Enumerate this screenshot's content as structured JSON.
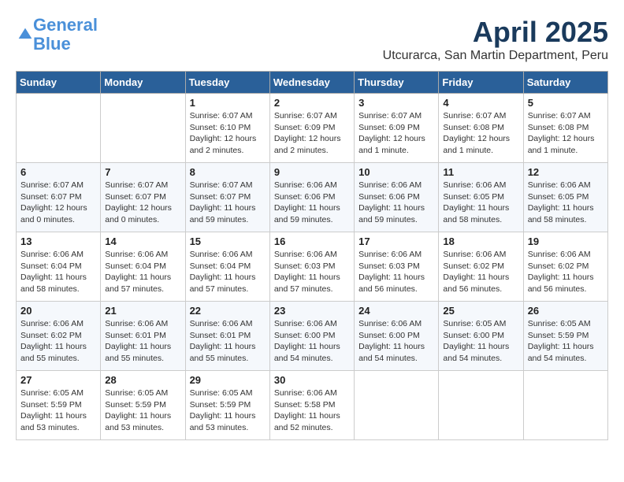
{
  "header": {
    "logo_line1": "General",
    "logo_line2": "Blue",
    "month": "April 2025",
    "location": "Utcurarca, San Martin Department, Peru"
  },
  "days_of_week": [
    "Sunday",
    "Monday",
    "Tuesday",
    "Wednesday",
    "Thursday",
    "Friday",
    "Saturday"
  ],
  "weeks": [
    [
      {
        "day": "",
        "text": ""
      },
      {
        "day": "",
        "text": ""
      },
      {
        "day": "1",
        "text": "Sunrise: 6:07 AM\nSunset: 6:10 PM\nDaylight: 12 hours\nand 2 minutes."
      },
      {
        "day": "2",
        "text": "Sunrise: 6:07 AM\nSunset: 6:09 PM\nDaylight: 12 hours\nand 2 minutes."
      },
      {
        "day": "3",
        "text": "Sunrise: 6:07 AM\nSunset: 6:09 PM\nDaylight: 12 hours\nand 1 minute."
      },
      {
        "day": "4",
        "text": "Sunrise: 6:07 AM\nSunset: 6:08 PM\nDaylight: 12 hours\nand 1 minute."
      },
      {
        "day": "5",
        "text": "Sunrise: 6:07 AM\nSunset: 6:08 PM\nDaylight: 12 hours\nand 1 minute."
      }
    ],
    [
      {
        "day": "6",
        "text": "Sunrise: 6:07 AM\nSunset: 6:07 PM\nDaylight: 12 hours\nand 0 minutes."
      },
      {
        "day": "7",
        "text": "Sunrise: 6:07 AM\nSunset: 6:07 PM\nDaylight: 12 hours\nand 0 minutes."
      },
      {
        "day": "8",
        "text": "Sunrise: 6:07 AM\nSunset: 6:07 PM\nDaylight: 11 hours\nand 59 minutes."
      },
      {
        "day": "9",
        "text": "Sunrise: 6:06 AM\nSunset: 6:06 PM\nDaylight: 11 hours\nand 59 minutes."
      },
      {
        "day": "10",
        "text": "Sunrise: 6:06 AM\nSunset: 6:06 PM\nDaylight: 11 hours\nand 59 minutes."
      },
      {
        "day": "11",
        "text": "Sunrise: 6:06 AM\nSunset: 6:05 PM\nDaylight: 11 hours\nand 58 minutes."
      },
      {
        "day": "12",
        "text": "Sunrise: 6:06 AM\nSunset: 6:05 PM\nDaylight: 11 hours\nand 58 minutes."
      }
    ],
    [
      {
        "day": "13",
        "text": "Sunrise: 6:06 AM\nSunset: 6:04 PM\nDaylight: 11 hours\nand 58 minutes."
      },
      {
        "day": "14",
        "text": "Sunrise: 6:06 AM\nSunset: 6:04 PM\nDaylight: 11 hours\nand 57 minutes."
      },
      {
        "day": "15",
        "text": "Sunrise: 6:06 AM\nSunset: 6:04 PM\nDaylight: 11 hours\nand 57 minutes."
      },
      {
        "day": "16",
        "text": "Sunrise: 6:06 AM\nSunset: 6:03 PM\nDaylight: 11 hours\nand 57 minutes."
      },
      {
        "day": "17",
        "text": "Sunrise: 6:06 AM\nSunset: 6:03 PM\nDaylight: 11 hours\nand 56 minutes."
      },
      {
        "day": "18",
        "text": "Sunrise: 6:06 AM\nSunset: 6:02 PM\nDaylight: 11 hours\nand 56 minutes."
      },
      {
        "day": "19",
        "text": "Sunrise: 6:06 AM\nSunset: 6:02 PM\nDaylight: 11 hours\nand 56 minutes."
      }
    ],
    [
      {
        "day": "20",
        "text": "Sunrise: 6:06 AM\nSunset: 6:02 PM\nDaylight: 11 hours\nand 55 minutes."
      },
      {
        "day": "21",
        "text": "Sunrise: 6:06 AM\nSunset: 6:01 PM\nDaylight: 11 hours\nand 55 minutes."
      },
      {
        "day": "22",
        "text": "Sunrise: 6:06 AM\nSunset: 6:01 PM\nDaylight: 11 hours\nand 55 minutes."
      },
      {
        "day": "23",
        "text": "Sunrise: 6:06 AM\nSunset: 6:00 PM\nDaylight: 11 hours\nand 54 minutes."
      },
      {
        "day": "24",
        "text": "Sunrise: 6:06 AM\nSunset: 6:00 PM\nDaylight: 11 hours\nand 54 minutes."
      },
      {
        "day": "25",
        "text": "Sunrise: 6:05 AM\nSunset: 6:00 PM\nDaylight: 11 hours\nand 54 minutes."
      },
      {
        "day": "26",
        "text": "Sunrise: 6:05 AM\nSunset: 5:59 PM\nDaylight: 11 hours\nand 54 minutes."
      }
    ],
    [
      {
        "day": "27",
        "text": "Sunrise: 6:05 AM\nSunset: 5:59 PM\nDaylight: 11 hours\nand 53 minutes."
      },
      {
        "day": "28",
        "text": "Sunrise: 6:05 AM\nSunset: 5:59 PM\nDaylight: 11 hours\nand 53 minutes."
      },
      {
        "day": "29",
        "text": "Sunrise: 6:05 AM\nSunset: 5:59 PM\nDaylight: 11 hours\nand 53 minutes."
      },
      {
        "day": "30",
        "text": "Sunrise: 6:06 AM\nSunset: 5:58 PM\nDaylight: 11 hours\nand 52 minutes."
      },
      {
        "day": "",
        "text": ""
      },
      {
        "day": "",
        "text": ""
      },
      {
        "day": "",
        "text": ""
      }
    ]
  ]
}
